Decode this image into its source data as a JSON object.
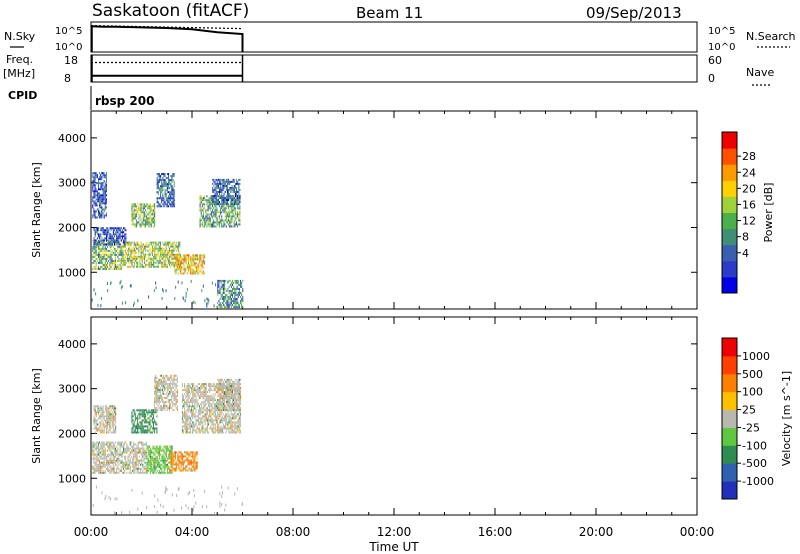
{
  "header": {
    "station": "Saskatoon (fitACF)",
    "beam": "Beam 11",
    "date": "09/Sep/2013"
  },
  "aux": {
    "nsky_label": "N.Sky",
    "nsky_ticks": [
      "10^5",
      "10^0"
    ],
    "nsearch_label": "N.Search",
    "nsearch_ticks": [
      "10^5",
      "10^0"
    ],
    "freq_label": "Freq.",
    "freq_unit": "[MHz]",
    "freq_ticks": [
      "18",
      "8"
    ],
    "nave_label": "Nave",
    "nave_ticks": [
      "60",
      "0"
    ],
    "cpid_label": "CPID",
    "cpid_value": "rbsp 200"
  },
  "x_axis": {
    "label": "Time UT",
    "ticks": [
      "00:00",
      "04:00",
      "08:00",
      "12:00",
      "16:00",
      "20:00",
      "00:00"
    ],
    "range_hours": [
      0,
      24
    ],
    "data_end_hour": 6
  },
  "chart_data": [
    {
      "type": "heatmap",
      "name": "power",
      "ylabel": "Slant Range [km]",
      "yticks": [
        "4000",
        "3000",
        "2000",
        "1000"
      ],
      "ylim": [
        180,
        4600
      ],
      "colorbar_label": "Power [dB]",
      "colorbar_ticks": [
        "28",
        "24",
        "20",
        "16",
        "12",
        "8",
        "4"
      ],
      "colorbar_colors": [
        "#0000e8",
        "#2a3cc8",
        "#3a5fb0",
        "#3f8f78",
        "#4cb04a",
        "#9fd23a",
        "#ffd000",
        "#ff9a00",
        "#ff5000",
        "#ee0000"
      ],
      "colorbar_range": [
        0,
        30
      ],
      "bands": [
        {
          "t0": 0.05,
          "t1": 1.2,
          "r0": 1050,
          "r1": 1700,
          "v": 14
        },
        {
          "t0": 1.2,
          "t1": 3.5,
          "r0": 1100,
          "r1": 1650,
          "v": 16
        },
        {
          "t0": 3.3,
          "t1": 4.5,
          "r0": 950,
          "r1": 1400,
          "v": 20
        },
        {
          "t0": 1.6,
          "t1": 2.5,
          "r0": 2000,
          "r1": 2500,
          "v": 14
        },
        {
          "t0": 2.6,
          "t1": 3.3,
          "r0": 2450,
          "r1": 3200,
          "v": 8
        },
        {
          "t0": 4.3,
          "t1": 5.9,
          "r0": 2000,
          "r1": 2700,
          "v": 12
        },
        {
          "t0": 4.8,
          "t1": 5.9,
          "r0": 2500,
          "r1": 3050,
          "v": 8
        },
        {
          "t0": 0.1,
          "t1": 1.4,
          "r0": 1600,
          "r1": 2000,
          "v": 6
        },
        {
          "t0": 0.05,
          "t1": 0.6,
          "r0": 2200,
          "r1": 3200,
          "v": 6
        },
        {
          "t0": 5.0,
          "t1": 6.0,
          "r0": 200,
          "r1": 800,
          "v": 10
        }
      ]
    },
    {
      "type": "heatmap",
      "name": "velocity",
      "ylabel": "Slant Range [km]",
      "yticks": [
        "4000",
        "3000",
        "2000",
        "1000"
      ],
      "ylim": [
        180,
        4600
      ],
      "colorbar_label": "Velocity [m s^-1]",
      "colorbar_ticks": [
        "1000",
        "500",
        "100",
        "25",
        "-25",
        "-100",
        "-500",
        "-1000"
      ],
      "colorbar_colors": [
        "#2030b8",
        "#3060b0",
        "#2e8c52",
        "#60c840",
        "#b8b8b0",
        "#ffc000",
        "#ff8000",
        "#ff4000",
        "#ee0000"
      ],
      "colorbar_values": [
        1200,
        700,
        300,
        60,
        0,
        -60,
        -300,
        -700,
        -1200
      ],
      "bands": [
        {
          "t0": 0.05,
          "t1": 2.2,
          "r0": 1100,
          "r1": 1800,
          "v": 0
        },
        {
          "t0": 2.2,
          "t1": 3.2,
          "r0": 1100,
          "r1": 1700,
          "v": 60
        },
        {
          "t0": 3.1,
          "t1": 4.2,
          "r0": 1150,
          "r1": 1600,
          "v": -300
        },
        {
          "t0": 1.6,
          "t1": 2.6,
          "r0": 2000,
          "r1": 2500,
          "v": 300
        },
        {
          "t0": 2.5,
          "t1": 3.4,
          "r0": 2500,
          "r1": 3300,
          "v": 0
        },
        {
          "t0": 3.6,
          "t1": 5.9,
          "r0": 2000,
          "r1": 3100,
          "v": 0
        },
        {
          "t0": 5.0,
          "t1": 5.9,
          "r0": 2500,
          "r1": 3200,
          "v": 0
        },
        {
          "t0": 0.1,
          "t1": 1.0,
          "r0": 2000,
          "r1": 2600,
          "v": 0
        }
      ]
    },
    {
      "type": "line",
      "name": "aux-traces",
      "x": [
        0,
        0.5,
        1,
        2,
        3,
        4,
        5,
        6
      ],
      "nsky_log": [
        4.3,
        4.2,
        4.2,
        4.1,
        4.0,
        3.8,
        3.3,
        3.0
      ],
      "freq_mhz": [
        10.3,
        10.3,
        10.3,
        10.3,
        10.3,
        10.3,
        10.3,
        10.3
      ],
      "nave": [
        30,
        30,
        30,
        30,
        30,
        30,
        30,
        30
      ]
    }
  ]
}
